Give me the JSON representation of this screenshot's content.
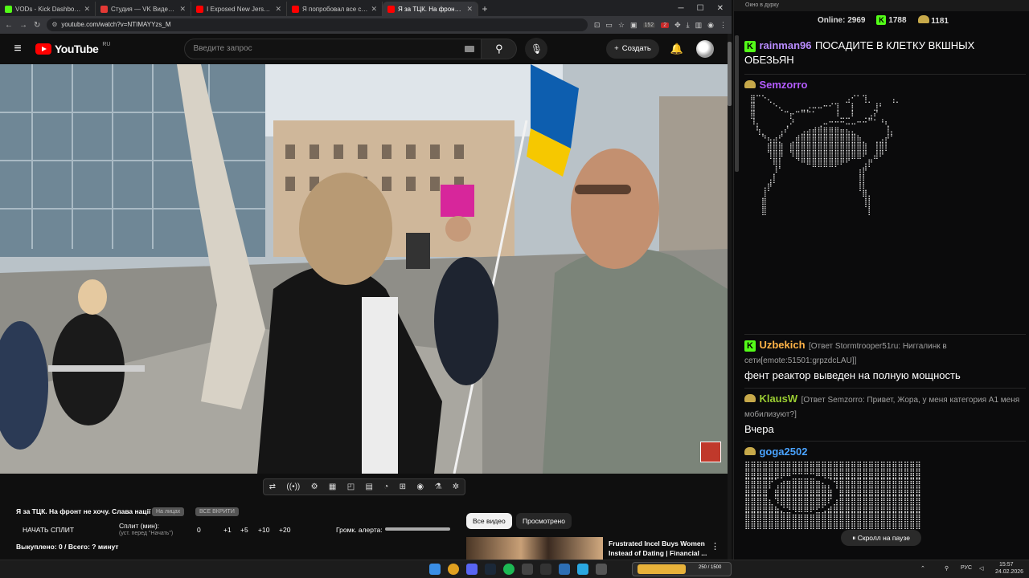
{
  "browser": {
    "tabs": [
      {
        "title": "VODs - Kick Dashboard",
        "color": "#53fc18"
      },
      {
        "title": "Студия — VK Видео Live",
        "color": "#e53935"
      },
      {
        "title": "I Exposed New Jersey's Jewish",
        "color": "#ff0000"
      },
      {
        "title": "Я попробовал все способы бр",
        "color": "#ff0000"
      },
      {
        "title": "Я за ТЦК. На фронт не хочу. С",
        "color": "#ff0000"
      }
    ],
    "new_tab": "+",
    "url": "youtube.com/watch?v=NTIMAYYzs_M",
    "badge_152": "152",
    "badge_2": "2"
  },
  "youtube": {
    "logo": "YouTube",
    "region": "RU",
    "search_placeholder": "Введите запрос",
    "create_label": "Создать"
  },
  "stream_tool": {
    "title": "Я за ТЦК. На фронт не хочу. Слава нації",
    "pill_1": "На лицах",
    "pill_2": "ВСЕ ВКРИТИ",
    "start_split": "НАЧАТЬ СПЛИТ",
    "split_label": "Сплит (мин):",
    "split_sub": "(уст. перед \"Начать\")",
    "split_value": "0",
    "increments": [
      "+1",
      "+5",
      "+10",
      "+20"
    ],
    "alert_volume": "Громк. алерта:",
    "bought": "Выкуплено: 0 / Всего: ? минут",
    "chip_all": "Все видео",
    "chip_watched": "Просмотрено",
    "rec_title_1": "Frustrated Incel Buys Women",
    "rec_title_2": "Instead of Dating | Financial ..."
  },
  "chat": {
    "window_title": "Окно в дурку",
    "online_label": "Online:",
    "online_value": "2969",
    "kick_count": "1788",
    "other_count": "1181",
    "messages": [
      {
        "user": "rainman96",
        "color": "#b98cff",
        "text": "ПОСАДИТЕ В КЛЕТКУ ВКШНЫХ ОБЕЗЬЯН"
      },
      {
        "user": "Semzorro",
        "color": "#b45cff",
        "text": ""
      },
      {
        "user": "Uzbekich",
        "color": "#ffb347",
        "reply": "[Ответ Stormtrooper51ru: Ниггалинк в сети[emote:51501:grpzdcLAU]]",
        "text": "фент реактор выведен на полную мощность"
      },
      {
        "user": "KlausW",
        "color": "#9acd32",
        "reply": "[Ответ Semzorro: Привет, Жора, у меня категория А1 меня мобилизуют?]",
        "text": "Вчера"
      },
      {
        "user": "goga2502",
        "color": "#4aa3ff",
        "text": ""
      }
    ],
    "paused_label": "Скролл на паузе"
  },
  "taskbar": {
    "lang": "РУС",
    "time": "15:57",
    "date": "24.02.2026",
    "widget_text": "250 / 1500"
  }
}
